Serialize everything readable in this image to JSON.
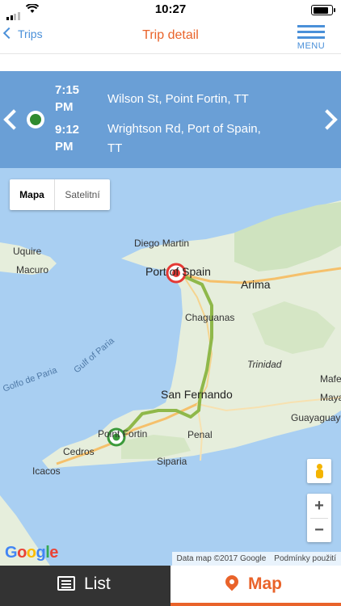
{
  "status_bar": {
    "time": "10:27"
  },
  "nav": {
    "back_label": "Trips",
    "title": "Trip detail",
    "menu_label": "MENU"
  },
  "trip": {
    "depart_time": "7:15 PM",
    "depart_time_line1": "7:15",
    "depart_time_line2": "PM",
    "depart_address": "Wilson St, Point Fortin, TT",
    "arrive_time": "9:12 PM",
    "arrive_time_line1": "9:12",
    "arrive_time_line2": "PM",
    "arrive_address_line1": "Wrightson Rd, Port of Spain,",
    "arrive_address_line2": "TT"
  },
  "map": {
    "toggle": {
      "map_label": "Mapa",
      "satellite_label": "Satelitní",
      "selected": "Mapa"
    },
    "labels": {
      "uquire": "Uquire",
      "macuro": "Macuro",
      "diego_martin": "Diego Martin",
      "port_of_spain": "Port of Spain",
      "arima": "Arima",
      "chaguanas": "Chaguanas",
      "trinidad": "Trinidad",
      "gulf_of_paria": "Gulf of Paria",
      "golfo_de_paria": "Golfo de Paria",
      "san_fernando": "San Fernando",
      "mafe": "Mafe",
      "maya": "Maya",
      "guayaguay": "Guayaguay",
      "point_fortin": "Point Fortin",
      "cedros": "Cedros",
      "penal": "Penal",
      "siparia": "Siparia",
      "icacos": "Icacos"
    },
    "zoom_in": "+",
    "zoom_out": "−",
    "google_logo": "Google",
    "attribution": "Data map ©2017 Google",
    "terms": "Podmínky použití",
    "colors": {
      "water": "#a9cff2",
      "land": "#e6eedc",
      "route": "#8fb84a",
      "start": "#3a9a3a",
      "end": "#e53935"
    }
  },
  "tabs": {
    "list_label": "List",
    "map_label": "Map",
    "active": "Map"
  },
  "colors": {
    "accent": "#e9632a",
    "link": "#4a90d9",
    "header_bg": "#6a9fd6",
    "tab_dark": "#333333"
  }
}
